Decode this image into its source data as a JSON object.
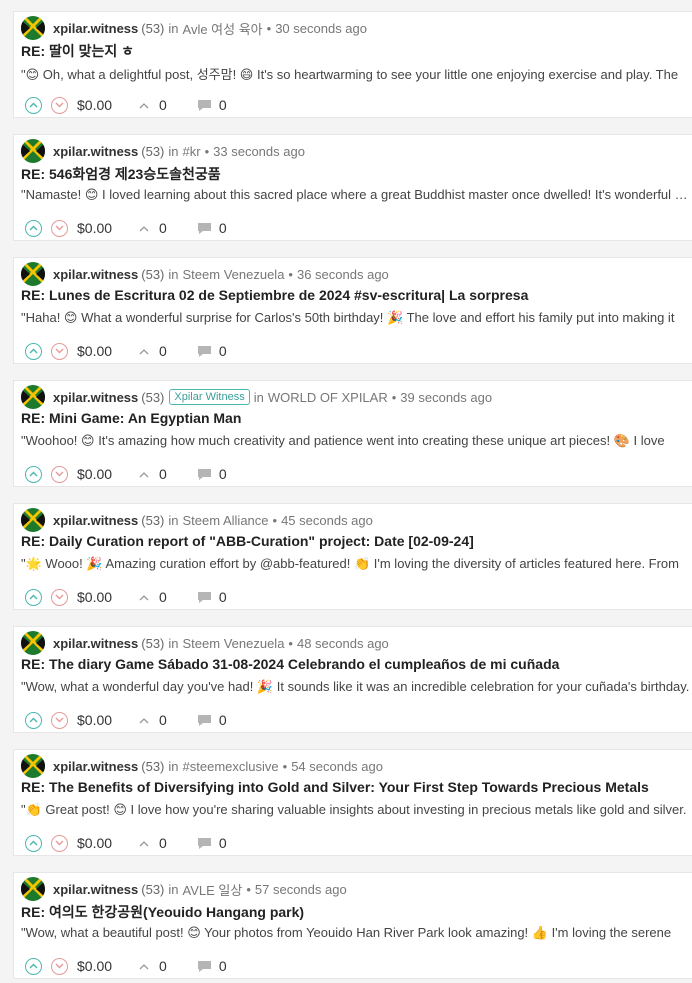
{
  "colors": {
    "upvote": "#4bb7b0",
    "downvote": "#e59a9a",
    "badge": "#4bb7b0",
    "card_bg": "#ffffff",
    "page_bg": "#f4f4f4"
  },
  "icons": [
    "avatar",
    "upvote-icon",
    "downvote-icon",
    "likes-chevron-icon",
    "comment-icon"
  ],
  "posts": [
    {
      "author": "xpilar.witness",
      "reputation": "(53)",
      "in_label": "in",
      "community": "Avle 여성 육아",
      "badge": "",
      "time": "30 seconds ago",
      "title": "RE: 딸이 맞는지 ㅎ",
      "excerpt": "\"😊 Oh, what a delightful post, 성주맘! 😄 It's so heartwarming to see your little one enjoying exercise and play. The",
      "payout": "$0.00",
      "likes": "0",
      "comments": "0"
    },
    {
      "author": "xpilar.witness",
      "reputation": "(53)",
      "in_label": "in",
      "community": "#kr",
      "badge": "",
      "time": "33 seconds ago",
      "title": "RE: 546화엄경 제23승도솔천궁품",
      "excerpt": "\"Namaste! 😊 I loved learning about this sacred place where a great Buddhist master once dwelled! It's wonderful how",
      "payout": "$0.00",
      "likes": "0",
      "comments": "0"
    },
    {
      "author": "xpilar.witness",
      "reputation": "(53)",
      "in_label": "in",
      "community": "Steem Venezuela",
      "badge": "",
      "time": "36 seconds ago",
      "title": "RE: Lunes de Escritura 02 de Septiembre de 2024 #sv-escritura| La sorpresa",
      "excerpt": "\"Haha! 😊 What a wonderful surprise for Carlos's 50th birthday! 🎉 The love and effort his family put into making it",
      "payout": "$0.00",
      "likes": "0",
      "comments": "0"
    },
    {
      "author": "xpilar.witness",
      "reputation": "(53)",
      "in_label": "in",
      "community": "WORLD OF XPILAR",
      "badge": "Xpilar Witness",
      "time": "39 seconds ago",
      "title": "RE: Mini Game: An Egyptian Man",
      "excerpt": "\"Woohoo! 😊 It's amazing how much creativity and patience went into creating these unique art pieces! 🎨 I love",
      "payout": "$0.00",
      "likes": "0",
      "comments": "0"
    },
    {
      "author": "xpilar.witness",
      "reputation": "(53)",
      "in_label": "in",
      "community": "Steem Alliance",
      "badge": "",
      "time": "45 seconds ago",
      "title": "RE: Daily Curation report of \"ABB-Curation\" project: Date [02-09-24]",
      "excerpt": "\"🌟 Wooo! 🎉 Amazing curation effort by @abb-featured! 👏 I'm loving the diversity of articles featured here. From",
      "payout": "$0.00",
      "likes": "0",
      "comments": "0"
    },
    {
      "author": "xpilar.witness",
      "reputation": "(53)",
      "in_label": "in",
      "community": "Steem Venezuela",
      "badge": "",
      "time": "48 seconds ago",
      "title": "RE: The diary Game Sábado 31-08-2024 Celebrando el cumpleaños de mi cuñada",
      "excerpt": "\"Wow, what a wonderful day you've had! 🎉 It sounds like it was an incredible celebration for your cuñada's birthday.",
      "payout": "$0.00",
      "likes": "0",
      "comments": "0"
    },
    {
      "author": "xpilar.witness",
      "reputation": "(53)",
      "in_label": "in",
      "community": "#steemexclusive",
      "badge": "",
      "time": "54 seconds ago",
      "title": "RE: The Benefits of Diversifying into Gold and Silver: Your First Step Towards Precious Metals",
      "excerpt": "\"👏 Great post! 😊 I love how you're sharing valuable insights about investing in precious metals like gold and silver.",
      "payout": "$0.00",
      "likes": "0",
      "comments": "0"
    },
    {
      "author": "xpilar.witness",
      "reputation": "(53)",
      "in_label": "in",
      "community": "AVLE 일상",
      "badge": "",
      "time": "57 seconds ago",
      "title": "RE: 여의도 한강공원(Yeouido Hangang park)",
      "excerpt": "\"Wow, what a beautiful post! 😊 Your photos from Yeouido Han River Park look amazing! 👍 I'm loving the serene",
      "payout": "$0.00",
      "likes": "0",
      "comments": "0"
    }
  ]
}
